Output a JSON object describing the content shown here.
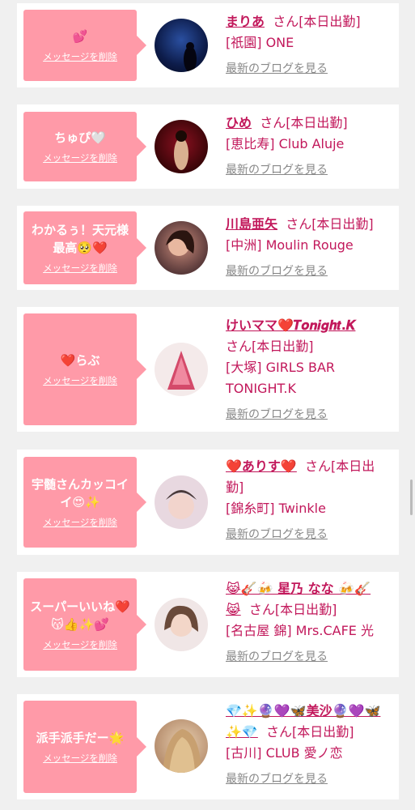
{
  "delete_label": "メッセージを削除",
  "blog_label": "最新のブログを見る",
  "san_suffix": "さん[本日出勤]",
  "cards": [
    {
      "message": "💕",
      "name": "まりあ",
      "shop": "[祇園] ONE"
    },
    {
      "message": "ちゅぴ🤍",
      "name": "ひめ",
      "shop": "[恵比寿] Club Aluje"
    },
    {
      "message": "わかるぅ！天元様最高🥺❤️",
      "name": "川島亜矢",
      "shop": "[中洲] Moulin Rouge"
    },
    {
      "message": "❤️らぶ",
      "name": "けいママ❤️𝑻𝒐𝒏𝒊𝒈𝒉𝒕.𝑲",
      "shop": "[大塚] GIRLS BAR TONIGHT.K"
    },
    {
      "message": "宇髄さんカッコイイ😍✨",
      "name": "❤️ありす❤️",
      "shop": "[錦糸町] Twinkle"
    },
    {
      "message": "スーパーいいね❤️😽👍✨💕",
      "name": "😹🎸🍻 星乃 なな 🍻🎸😹",
      "shop": "[名古屋 錦] Mrs.CAFE 光"
    },
    {
      "message": "派手派手だー🌟",
      "name": "💎✨🔮💜🦋美沙🔮💜🦋✨💎",
      "shop": "[古川] CLUB 愛ノ恋"
    }
  ],
  "colors": {
    "bubble": "#ff9aa8",
    "accent": "#c2185b",
    "background": "#f0f0f0"
  }
}
